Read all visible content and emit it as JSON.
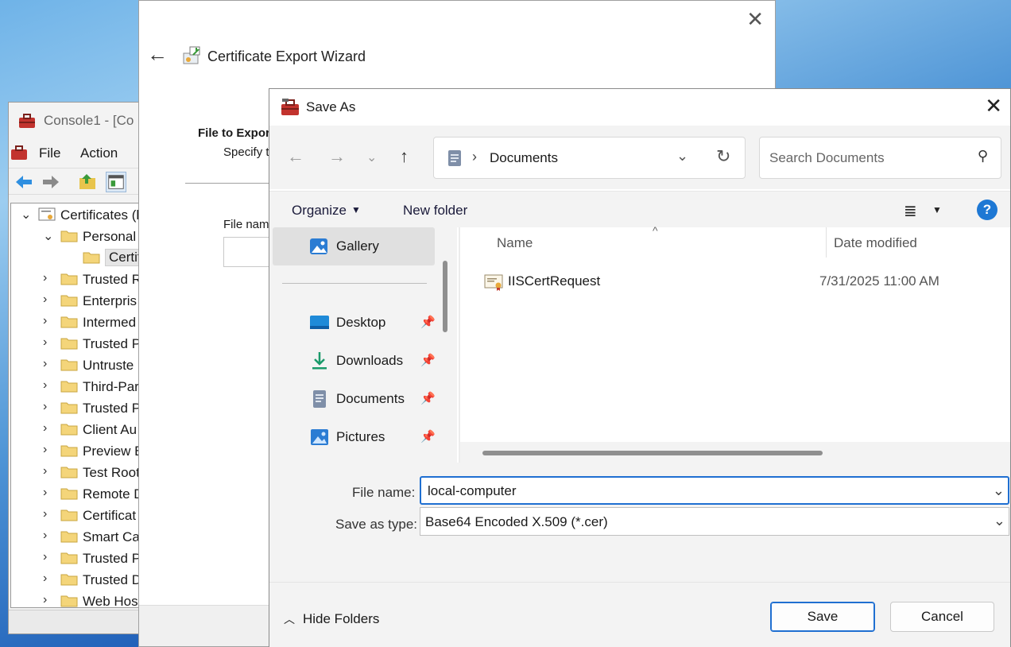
{
  "mmc": {
    "title": "Console1 - [Co",
    "menu": [
      "File",
      "Action"
    ],
    "tree": [
      {
        "label": "Certificates (l",
        "chevron": "v",
        "level": 0
      },
      {
        "label": "Personal",
        "chevron": "v",
        "level": 1
      },
      {
        "label": "Certif",
        "chevron": "",
        "level": 2,
        "selected": true
      },
      {
        "label": "Trusted R",
        "chevron": ">",
        "level": 1
      },
      {
        "label": "Enterpris",
        "chevron": ">",
        "level": 1
      },
      {
        "label": "Intermed",
        "chevron": ">",
        "level": 1
      },
      {
        "label": "Trusted P",
        "chevron": ">",
        "level": 1
      },
      {
        "label": "Untruste",
        "chevron": ">",
        "level": 1
      },
      {
        "label": "Third-Par",
        "chevron": ">",
        "level": 1
      },
      {
        "label": "Trusted P",
        "chevron": ">",
        "level": 1
      },
      {
        "label": "Client Au",
        "chevron": ">",
        "level": 1
      },
      {
        "label": "Preview B",
        "chevron": ">",
        "level": 1
      },
      {
        "label": "Test Root",
        "chevron": ">",
        "level": 1
      },
      {
        "label": "Remote D",
        "chevron": ">",
        "level": 1
      },
      {
        "label": "Certificat",
        "chevron": ">",
        "level": 1
      },
      {
        "label": "Smart Ca",
        "chevron": ">",
        "level": 1
      },
      {
        "label": "Trusted P",
        "chevron": ">",
        "level": 1
      },
      {
        "label": "Trusted D",
        "chevron": ">",
        "level": 1
      },
      {
        "label": "Web Hos",
        "chevron": ">",
        "level": 1
      }
    ]
  },
  "wizard": {
    "title": "Certificate Export Wizard",
    "step_title": "File to Export",
    "step_subtitle": "Specify t",
    "file_name_label": "File nam"
  },
  "saveas": {
    "title": "Save As",
    "breadcrumb": "Documents",
    "search_placeholder": "Search Documents",
    "organize_label": "Organize",
    "new_folder_label": "New folder",
    "help_label": "?",
    "nav_items": [
      {
        "label": "Gallery",
        "icon": "gallery-icon",
        "pinned": false,
        "selected": true
      },
      {
        "label": "Desktop",
        "icon": "desktop-icon",
        "pinned": true
      },
      {
        "label": "Downloads",
        "icon": "downloads-icon",
        "pinned": true
      },
      {
        "label": "Documents",
        "icon": "documents-icon",
        "pinned": true
      },
      {
        "label": "Pictures",
        "icon": "pictures-icon",
        "pinned": true
      }
    ],
    "columns": {
      "name": "Name",
      "date_modified": "Date modified"
    },
    "files": [
      {
        "name": "IISCertRequest",
        "date_modified": "7/31/2025 11:00 AM",
        "icon": "certificate-file-icon"
      }
    ],
    "file_name_label": "File name:",
    "file_name_value": "local-computer",
    "save_type_label": "Save as type:",
    "save_type_value": "Base64 Encoded X.509 (*.cer)",
    "hide_folders_label": "Hide Folders",
    "save_label": "Save",
    "cancel_label": "Cancel"
  },
  "colors": {
    "accent": "#1f6fd1",
    "folder": "#f4d57a",
    "help": "#1e78d4"
  }
}
